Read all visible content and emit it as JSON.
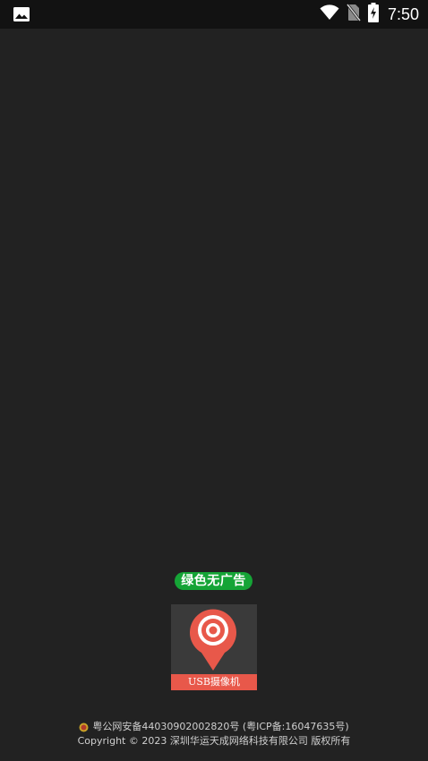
{
  "status_bar": {
    "time": "7:50",
    "icons": [
      "image-icon",
      "wifi-icon",
      "no-sim-icon",
      "battery-charging-icon"
    ]
  },
  "badge": {
    "label": "绿色无广告",
    "color": "#15a436"
  },
  "app_logo": {
    "label": "USB摄像机",
    "brand_color": "#e8584a",
    "icon": "camera-pin-icon"
  },
  "footer": {
    "police_icon": "police-badge-icon",
    "record_text": "粤公网安备44030902002820号 (粤ICP备:16047635号)",
    "copyright": "Copyright © 2023 深圳华运天成网络科技有限公司 版权所有"
  }
}
